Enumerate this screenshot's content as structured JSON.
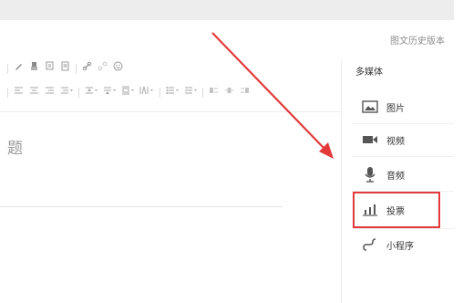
{
  "header": {
    "history_link": "图文历史版本"
  },
  "editor": {
    "title_fragment": "题"
  },
  "toolbar": {
    "row1": [
      "pen-icon",
      "eraser-icon",
      "format-painter-icon",
      "document-icon",
      "link-icon",
      "unlink-icon",
      "emoji-icon"
    ],
    "row2": [
      "align-left-icon",
      "align-center-icon",
      "align-right-icon",
      "indent-icon",
      "line-height-icon",
      "paragraph-spacing-icon",
      "letter-spacing-icon",
      "font-size-icon",
      "list-icon",
      "list-dropdown-icon",
      "image-left-icon",
      "image-center-icon",
      "image-right-icon"
    ]
  },
  "media_panel": {
    "title": "多媒体",
    "items": [
      {
        "label": "图片",
        "icon": "image-icon"
      },
      {
        "label": "视频",
        "icon": "video-icon"
      },
      {
        "label": "音频",
        "icon": "microphone-icon"
      },
      {
        "label": "投票",
        "icon": "vote-icon"
      },
      {
        "label": "小程序",
        "icon": "mini-program-icon"
      }
    ]
  },
  "annotation": {
    "highlight_color": "#e23a3a",
    "arrow_color": "#e23a3a"
  }
}
